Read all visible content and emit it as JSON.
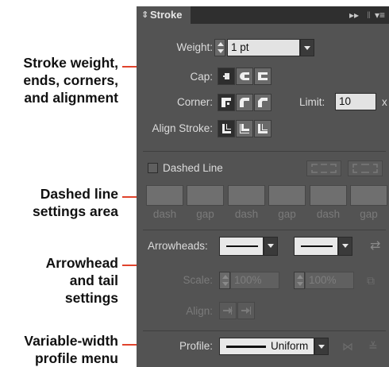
{
  "callouts": {
    "stroke_options": [
      "Stroke weight,",
      "ends, corners,",
      "and alignment"
    ],
    "dashed_line": [
      "Dashed line",
      "settings area"
    ],
    "arrowhead": [
      "Arrowhead",
      "and tail",
      "settings"
    ],
    "profile": [
      "Variable-width",
      "profile menu"
    ]
  },
  "panel": {
    "tab_icon": "⇕",
    "tab_title": "Stroke",
    "header_controls": [
      "▸▸",
      "‖",
      "▾≡"
    ],
    "weight": {
      "label": "Weight:",
      "value": "1 pt"
    },
    "cap": {
      "label": "Cap:",
      "options": [
        "butt-cap",
        "round-cap",
        "projecting-cap"
      ],
      "selected": "butt-cap"
    },
    "corner": {
      "label": "Corner:",
      "options": [
        "miter-join",
        "round-join",
        "bevel-join"
      ],
      "selected": "miter-join",
      "limit_label": "Limit:",
      "limit_value": "10",
      "limit_suffix": "x"
    },
    "align": {
      "label": "Align Stroke:",
      "options": [
        "align-center",
        "align-inside",
        "align-outside"
      ],
      "selected": "align-center"
    },
    "dashed": {
      "label": "Dashed Line",
      "checked": false,
      "labels": [
        "dash",
        "gap",
        "dash",
        "gap",
        "dash",
        "gap"
      ]
    },
    "arrowheads": {
      "label": "Arrowheads:",
      "swap_icon": "⇄",
      "scale_label": "Scale:",
      "scale_start": "100%",
      "scale_end": "100%",
      "link_icon": "⧉",
      "align_label": "Align:"
    },
    "profile": {
      "label": "Profile:",
      "value": "Uniform",
      "flip_h_icon": "⋈",
      "flip_v_icon": "≚"
    }
  },
  "colors": {
    "panel": "#535353",
    "header": "#2f2f2f",
    "leader": "#e0432c"
  }
}
